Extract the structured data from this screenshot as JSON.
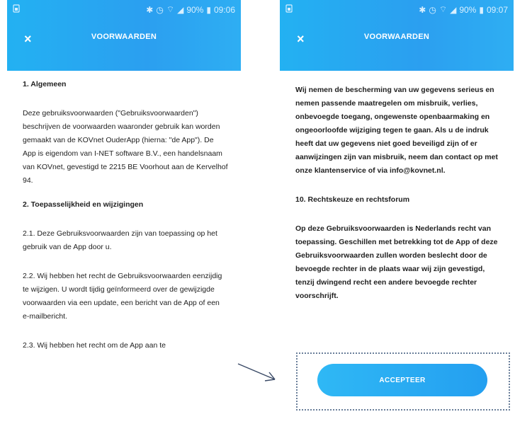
{
  "status": {
    "battery": "90%",
    "time_left": "09:06",
    "time_right": "09:07"
  },
  "header": {
    "title": "VOORWAARDEN",
    "close_icon": "×"
  },
  "left": {
    "h1": "1. Algemeen",
    "p1": "Deze gebruiksvoorwaarden (\"Gebruiksvoorwaarden\") beschrijven de voorwaarden waaronder gebruik kan worden gemaakt van de KOVnet OuderApp (hierna: \"de App\"). De App is eigendom van I-NET software B.V., een handelsnaam van KOVnet, gevestigd te 2215 BE Voorhout aan de Kervelhof 94.",
    "h2": "2. Toepasselijkheid en wijzigingen",
    "p21": "2.1. Deze Gebruiksvoorwaarden zijn van toepassing op het gebruik van de App door u.",
    "p22": "2.2. Wij hebben het recht de Gebruiksvoorwaarden eenzijdig te wijzigen. U wordt tijdig geïnformeerd over de gewijzigde voorwaarden via een update, een bericht van de App of een e-mailbericht.",
    "p23": "2.3. Wij hebben het recht om de App aan te"
  },
  "right": {
    "p1": "Wij nemen de bescherming van uw gegevens serieus en nemen passende maatregelen om misbruik, verlies, onbevoegde toegang, ongewenste openbaarmaking en ongeoorloofde wijziging tegen te gaan. Als u de indruk heeft dat uw gegevens niet goed beveiligd zijn of er aanwijzingen zijn van misbruik, neem dan contact op met onze klantenservice of via info@kovnet.nl.",
    "h10": "10. Rechtskeuze en rechtsforum",
    "p10": "Op deze Gebruiksvoorwaarden is Nederlands recht van toepassing. Geschillen met betrekking tot de App of deze Gebruiksvoorwaarden zullen worden beslecht door de bevoegde rechter in de plaats waar wij zijn gevestigd, tenzij dwingend recht een andere bevoegde rechter voorschrijft.",
    "accept": "ACCEPTEER"
  }
}
